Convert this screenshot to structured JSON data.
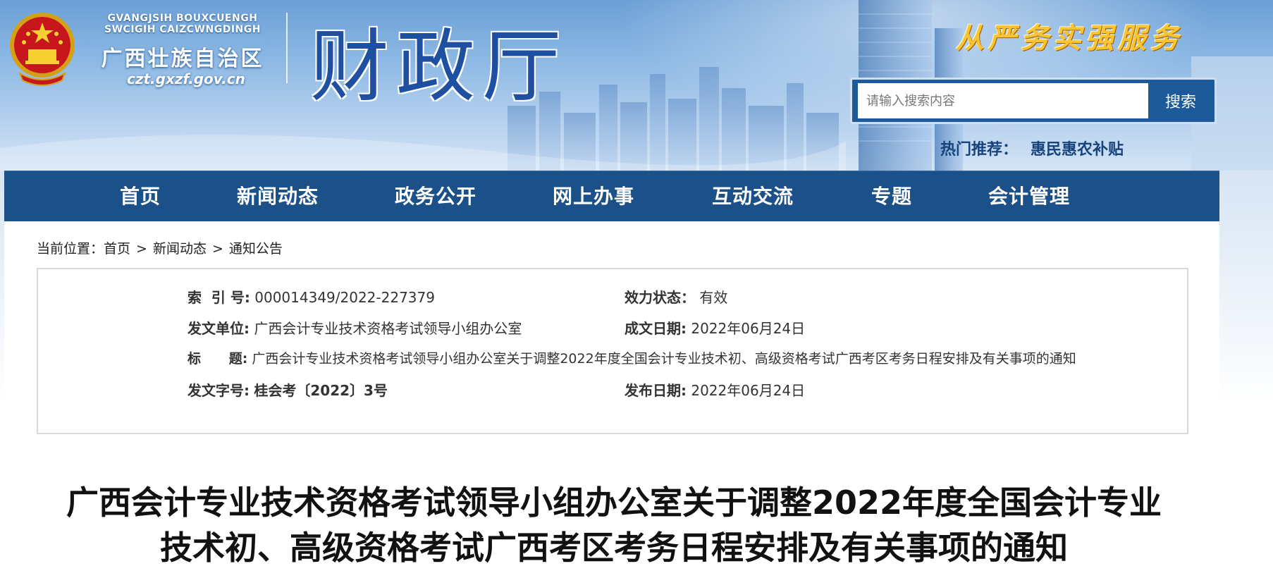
{
  "header": {
    "emblem_icon": "national-emblem-icon",
    "english_name": "GVANGJSIH BOUXCUENGH SWCIGIH CAIZCWNGDINGH",
    "chinese_name": "广西壮族自治区",
    "domain": "czt.gxzf.gov.cn",
    "department": "财政厅",
    "slogan": "从严务实强服务"
  },
  "search": {
    "placeholder": "请输入搜索内容",
    "button_label": "搜索"
  },
  "hot": {
    "label": "热门推荐：",
    "link": "惠民惠农补贴"
  },
  "nav": {
    "items": [
      "首页",
      "新闻动态",
      "政务公开",
      "网上办事",
      "互动交流",
      "专题",
      "会计管理"
    ]
  },
  "breadcrumb": {
    "prefix": "当前位置：",
    "items": [
      "首页",
      "新闻动态",
      "通知公告"
    ],
    "separator": ">"
  },
  "info": {
    "index_label": "索  引 号:",
    "index_value": "000014349/2022-227379",
    "status_label": "效力状态：",
    "status_value": "有效",
    "issuer_label": "发文单位:",
    "issuer_value": "广西会计专业技术资格考试领导小组办公室",
    "date_label": "成文日期:",
    "date_value": "2022年06月24日",
    "title_label": "标      题:",
    "title_value": "广西会计专业技术资格考试领导小组办公室关于调整2022年度全国会计专业技术初、高级资格考试广西考区考务日程安排及有关事项的通知",
    "docno_label": "发文字号:",
    "docno_value": "桂会考〔2022〕3号",
    "pub_label": "发布日期:",
    "pub_value": "2022年06月24日"
  },
  "article": {
    "title_line1": "广西会计专业技术资格考试领导小组办公室关于调整2022年度全国会计专业",
    "title_line2": "技术初、高级资格考试广西考区考务日程安排及有关事项的通知"
  },
  "colors": {
    "nav_bg": "#1b5188",
    "brand_blue": "#1f4fa0",
    "slogan_gold": "#f7c531",
    "search_bg": "#1c5a9a"
  }
}
